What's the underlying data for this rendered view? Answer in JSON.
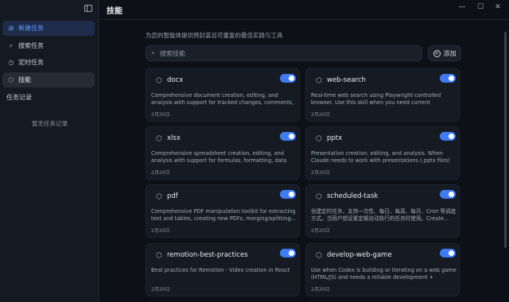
{
  "sidebar": {
    "items": [
      {
        "label": "新建任务",
        "icon": "square-plus-icon"
      },
      {
        "label": "搜索任务",
        "icon": "search-icon"
      },
      {
        "label": "定时任务",
        "icon": "clock-icon"
      },
      {
        "label": "技能",
        "icon": "cube-icon"
      }
    ],
    "section_label": "任务记录",
    "empty_text": "暂无任务记录"
  },
  "header": {
    "title": "技能"
  },
  "main": {
    "subtitle": "为您的智能体提供预封装且可重复的最佳实践与工具",
    "search_placeholder": "搜索技能",
    "add_label": "添加"
  },
  "skills": [
    {
      "name": "docx",
      "desc": "Comprehensive document creation, editing, and analysis with support for tracked changes, comments, formatting...",
      "date": "2月20日",
      "enabled": true
    },
    {
      "name": "web-search",
      "desc": "Real-time web search using Playwright-controlled browser. Use this skill when you need current information, latest...",
      "date": "2月20日",
      "enabled": true
    },
    {
      "name": "xlsx",
      "desc": "Comprehensive spreadsheet creation, editing, and analysis with support for formulas, formatting, data analysis, and...",
      "date": "2月20日",
      "enabled": true
    },
    {
      "name": "pptx",
      "desc": "Presentation creation, editing, and analysis. When Claude needs to work with presentations (.pptx files) for: (1)...",
      "date": "2月20日",
      "enabled": true
    },
    {
      "name": "pdf",
      "desc": "Comprehensive PDF manipulation toolkit for extracting text and tables, creating new PDFs, merging/splitting...",
      "date": "2月20日",
      "enabled": true
    },
    {
      "name": "scheduled-task",
      "desc": "创建定时任务，支持一次性、每日、每周、每月、Cron 等调度方式。当用户想设置定期自动执行的任务时使用。Create...",
      "date": "2月20日",
      "enabled": true
    },
    {
      "name": "remotion-best-practices",
      "desc": "Best practices for Remotion - Video creation in React",
      "date": "2月20日",
      "enabled": true
    },
    {
      "name": "develop-web-game",
      "desc": "Use when Codex is building or iterating on a web game (HTML/JS) and needs a reliable development + testing...",
      "date": "2月20日",
      "enabled": true
    }
  ],
  "colors": {
    "accent": "#3d7cf5",
    "active_nav_text": "#5f9cff",
    "background": "#0d1017"
  }
}
